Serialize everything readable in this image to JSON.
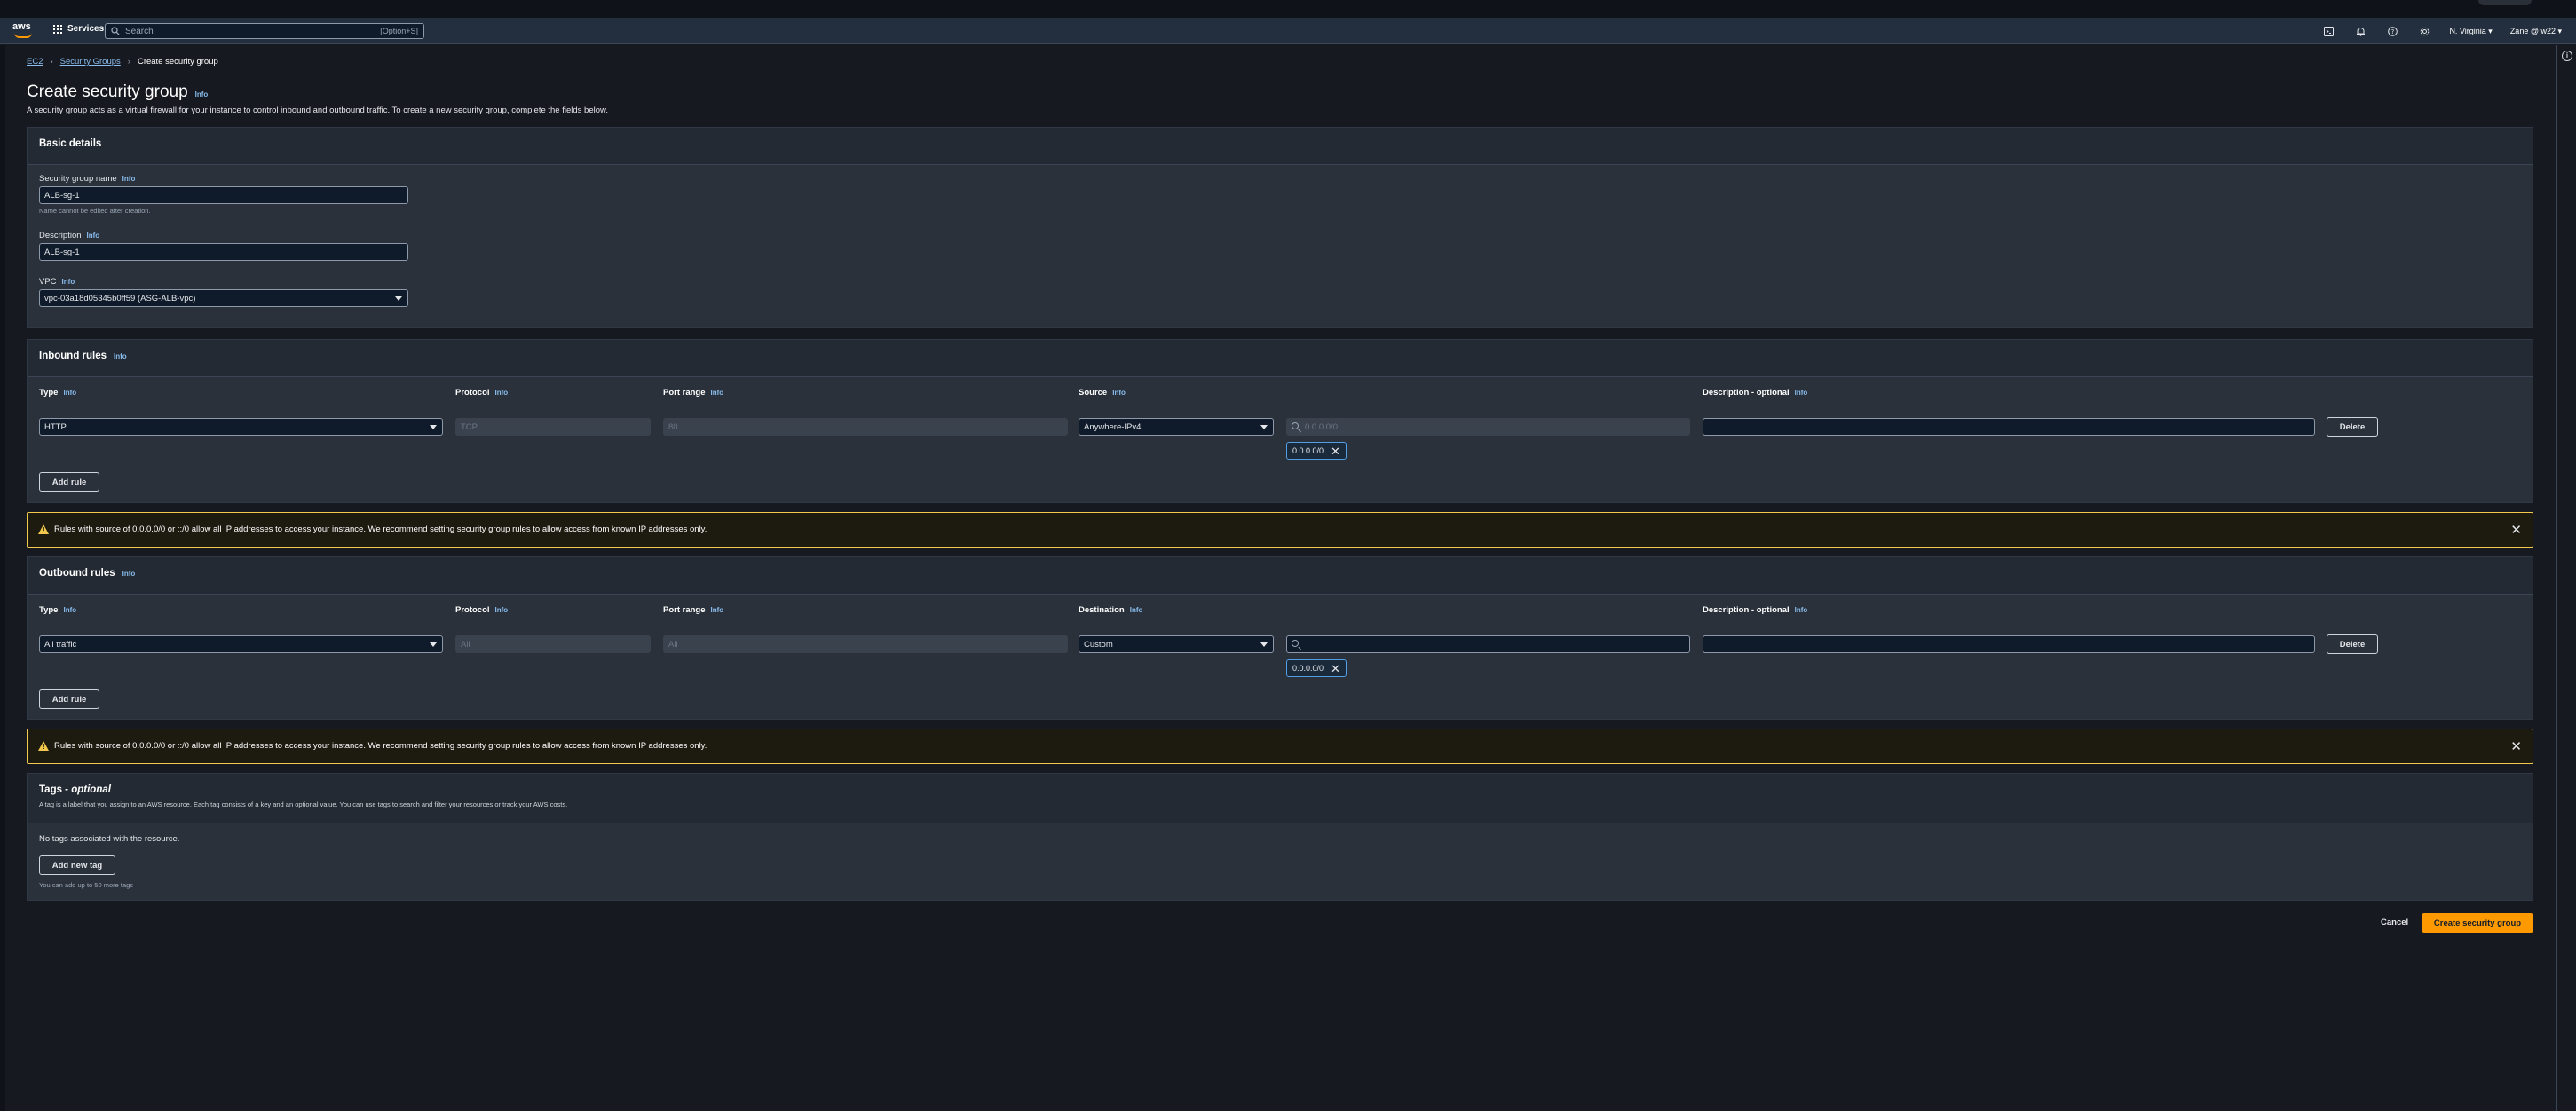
{
  "nav": {
    "logo": "aws",
    "services": "Services",
    "search_placeholder": "Search",
    "search_shortcut": "[Option+S]",
    "region": "N. Virginia ▾",
    "account": "Zane @ w22 ▾",
    "icons": [
      "cloudshell-icon",
      "bell-icon",
      "help-icon",
      "gear-icon"
    ]
  },
  "breadcrumb": {
    "ec2": "EC2",
    "security_groups": "Security Groups",
    "current": "Create security group"
  },
  "page": {
    "title": "Create security group",
    "info": "Info",
    "description": "A security group acts as a virtual firewall for your instance to control inbound and outbound traffic. To create a new security group, complete the fields below."
  },
  "basic": {
    "title": "Basic details",
    "name_label": "Security group name",
    "name_value": "ALB-sg-1",
    "name_hint": "Name cannot be edited after creation.",
    "desc_label": "Description",
    "desc_value": "ALB-sg-1",
    "vpc_label": "VPC",
    "vpc_value": "vpc-03a18d05345b0ff59 (ASG-ALB-vpc)",
    "info": "Info"
  },
  "inbound": {
    "title": "Inbound rules",
    "info": "Info",
    "col_type": "Type",
    "col_protocol": "Protocol",
    "col_port": "Port range",
    "col_source": "Source",
    "col_desc": "Description - optional",
    "type_value": "HTTP",
    "protocol_value": "TCP",
    "port_value": "80",
    "source_value": "Anywhere-IPv4",
    "cidr_placeholder": "0.0.0.0/0",
    "token": "0.0.0.0/0",
    "delete": "Delete",
    "add_rule": "Add rule"
  },
  "alert": {
    "message": "Rules with source of 0.0.0.0/0 or ::/0 allow all IP addresses to access your instance. We recommend setting security group rules to allow access from known IP addresses only."
  },
  "outbound": {
    "title": "Outbound rules",
    "info": "Info",
    "col_type": "Type",
    "col_protocol": "Protocol",
    "col_port": "Port range",
    "col_dest": "Destination",
    "col_desc": "Description - optional",
    "type_value": "All traffic",
    "protocol_value": "All",
    "port_value": "All",
    "dest_value": "Custom",
    "token": "0.0.0.0/0",
    "delete": "Delete",
    "add_rule": "Add rule"
  },
  "tags": {
    "title": "Tags - ",
    "title_optional": "optional",
    "description": "A tag is a label that you assign to an AWS resource. Each tag consists of a key and an optional value. You can use tags to search and filter your resources or track your AWS costs.",
    "empty": "No tags associated with the resource.",
    "add": "Add new tag",
    "hint": "You can add up to 50 more tags"
  },
  "footer": {
    "cancel": "Cancel",
    "create": "Create security group"
  },
  "colors": {
    "accent": "#ff9900",
    "link": "#89bdee",
    "warning": "#f2c94c"
  }
}
